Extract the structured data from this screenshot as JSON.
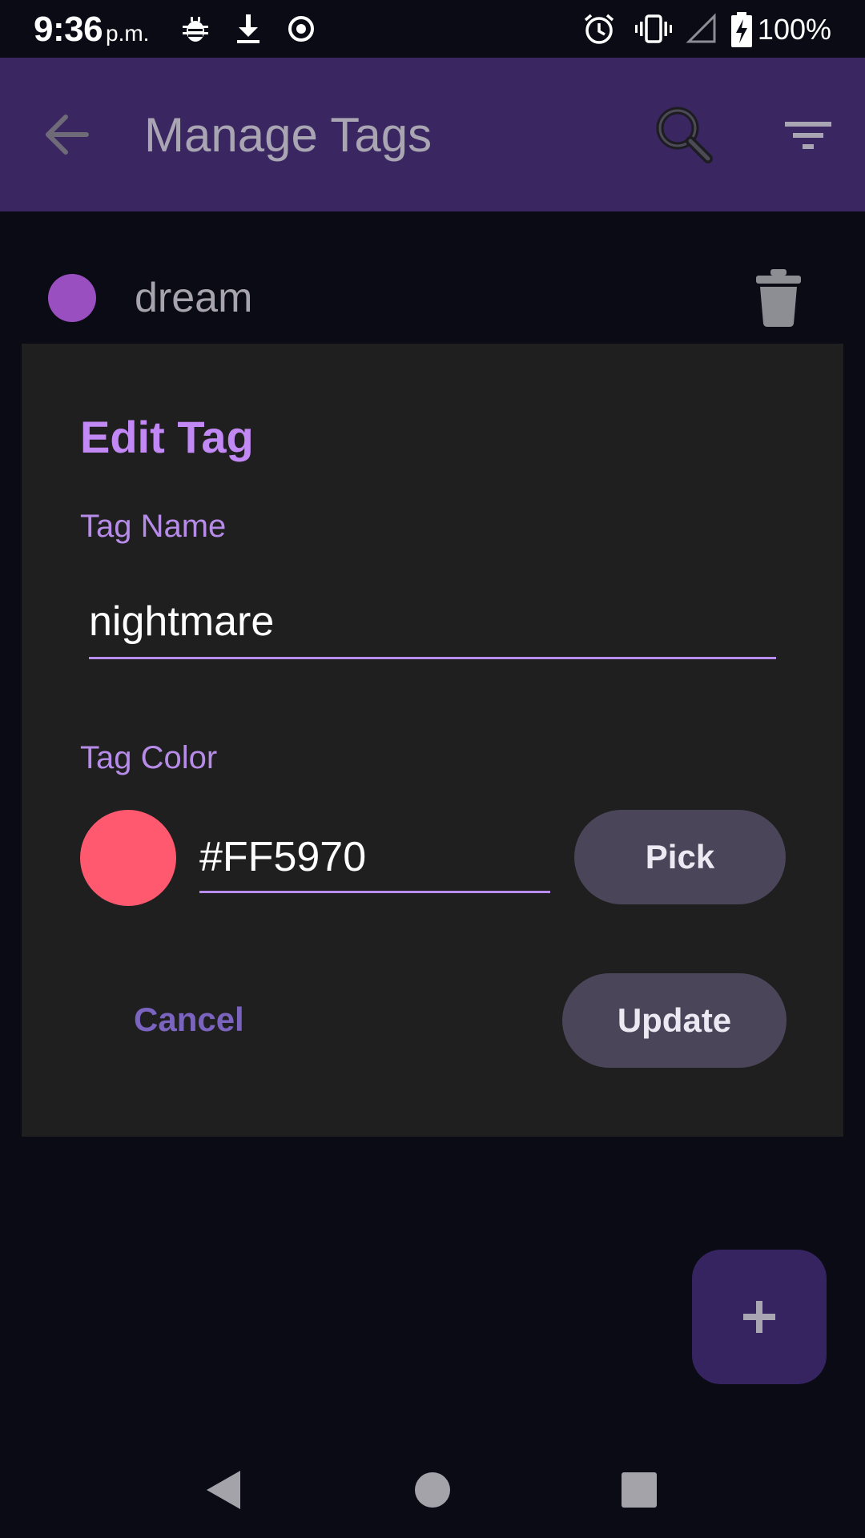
{
  "status_bar": {
    "time": "9:36",
    "ampm": "p.m.",
    "battery": "100%",
    "icons": [
      "bug-icon",
      "download-icon",
      "record-icon",
      "alarm-icon",
      "vibrate-icon",
      "signal-icon",
      "battery-charging-icon"
    ]
  },
  "app_bar": {
    "title": "Manage Tags",
    "icons": [
      "back-arrow-icon",
      "search-icon",
      "filter-icon"
    ]
  },
  "tag_list": [
    {
      "label": "dream",
      "color": "#9a4fc0",
      "action_icon": "trash-icon"
    }
  ],
  "dialog": {
    "title": "Edit Tag",
    "name_label": "Tag Name",
    "name_value": "nightmare",
    "color_label": "Tag Color",
    "color_value": "#FF5970",
    "swatch_color": "#ff5970",
    "pick_label": "Pick",
    "cancel_label": "Cancel",
    "update_label": "Update"
  },
  "fab": {
    "icon": "plus-icon"
  },
  "nav_bar": {
    "icons": [
      "nav-back-icon",
      "nav-home-icon",
      "nav-recents-icon"
    ]
  },
  "colors": {
    "background": "#0b0b16",
    "app_bar": "#3a2661",
    "dialog": "#1f1f1f",
    "accent": "#c289f4",
    "button": "#4a4559",
    "fab": "#35245f"
  }
}
